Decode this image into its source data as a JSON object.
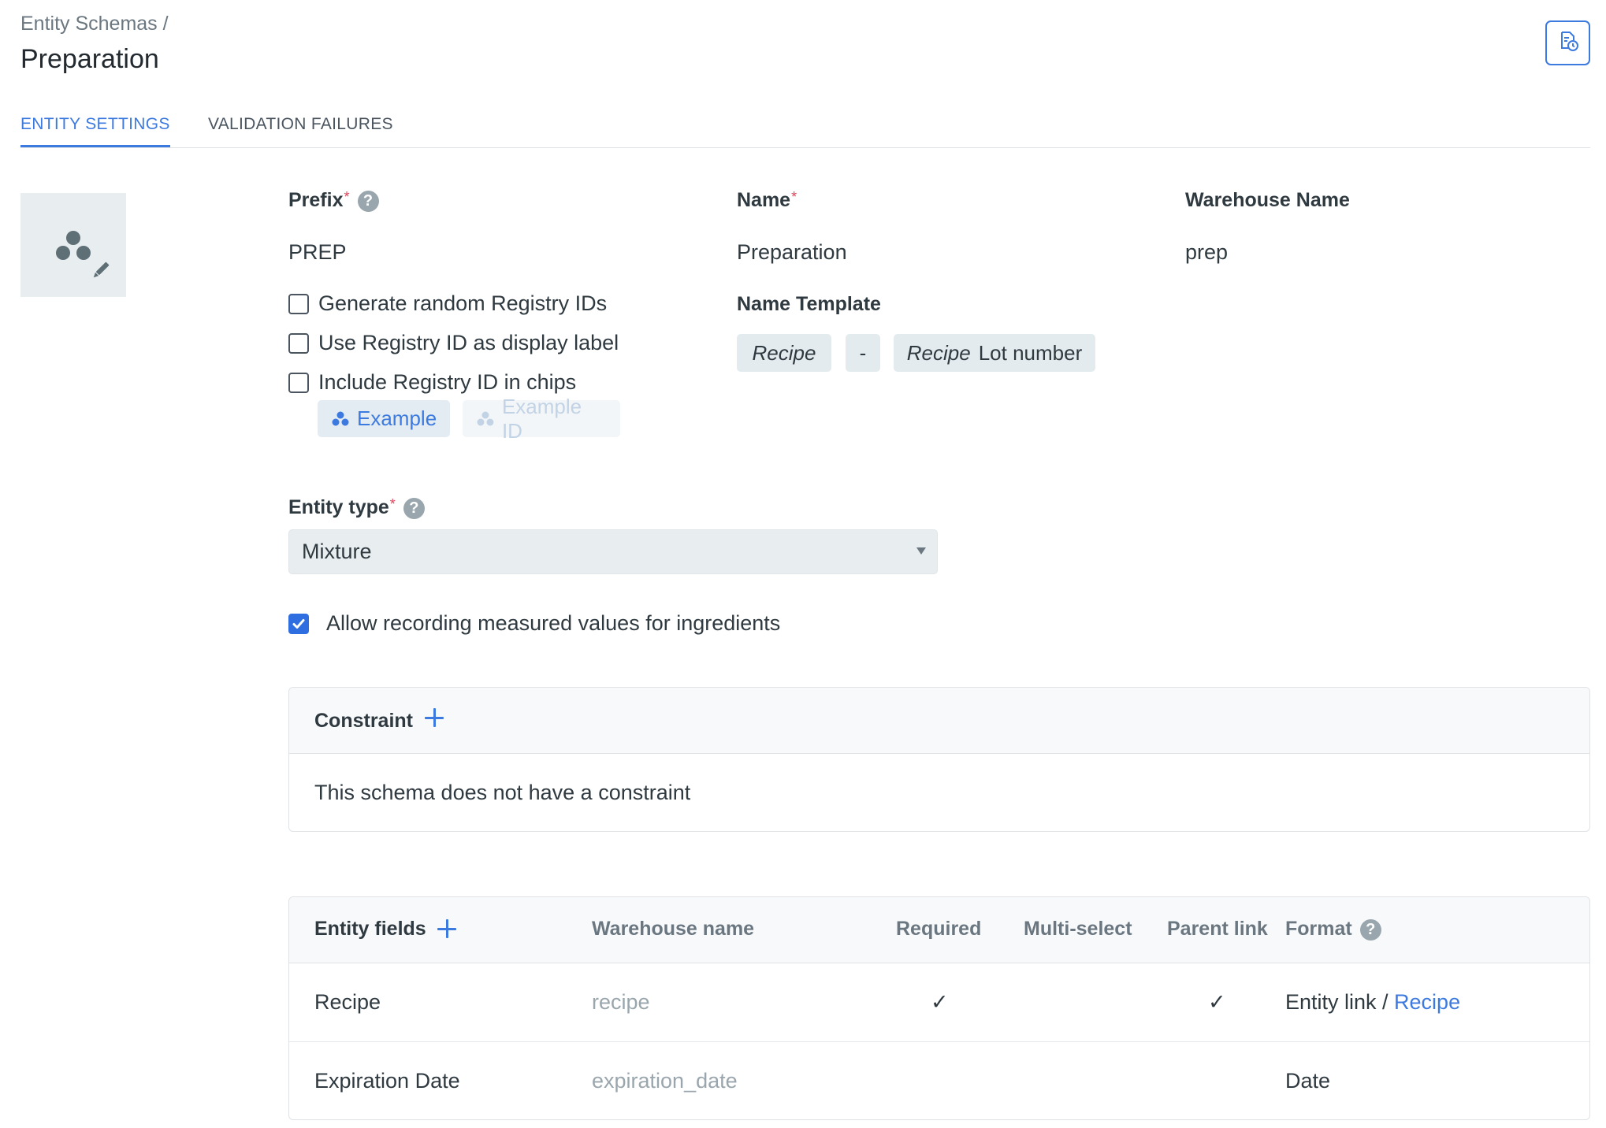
{
  "breadcrumb": {
    "parent": "Entity Schemas /"
  },
  "page": {
    "title": "Preparation"
  },
  "header": {
    "history_icon": "history-document-icon"
  },
  "tabs": [
    {
      "label": "ENTITY SETTINGS",
      "active": true
    },
    {
      "label": "VALIDATION FAILURES",
      "active": false
    }
  ],
  "settings": {
    "prefix_label": "Prefix",
    "prefix_value": "PREP",
    "name_label": "Name",
    "name_value": "Preparation",
    "warehouse_label": "Warehouse Name",
    "warehouse_value": "prep",
    "required_mark": "*",
    "help_mark": "?",
    "checkboxes": [
      {
        "label": "Generate random Registry IDs",
        "checked": false
      },
      {
        "label": "Use Registry ID as display label",
        "checked": false
      },
      {
        "label": "Include Registry ID in chips",
        "checked": false
      }
    ],
    "chip_examples": {
      "example": "Example",
      "example_id": "Example ID"
    },
    "name_template_label": "Name Template",
    "name_template": [
      {
        "italic": "Recipe",
        "plain": ""
      },
      {
        "italic": "",
        "plain": "-"
      },
      {
        "italic": "Recipe",
        "plain": "Lot number"
      }
    ],
    "entity_type_label": "Entity type",
    "entity_type_value": "Mixture",
    "allow_measured": {
      "label": "Allow recording measured values for ingredients",
      "checked": true
    }
  },
  "constraint": {
    "title": "Constraint",
    "empty_text": "This schema does not have a constraint"
  },
  "fields": {
    "headers": {
      "name": "Entity fields",
      "warehouse": "Warehouse name",
      "required": "Required",
      "multi": "Multi-select",
      "parent": "Parent link",
      "format": "Format"
    },
    "rows": [
      {
        "name": "Recipe",
        "warehouse": "recipe",
        "required": "✓",
        "multi": "",
        "parent": "✓",
        "format": "Entity link / ",
        "format_link": "Recipe"
      },
      {
        "name": "Expiration Date",
        "warehouse": "expiration_date",
        "required": "",
        "multi": "",
        "parent": "",
        "format": "Date",
        "format_link": ""
      }
    ]
  },
  "colors": {
    "accent": "#3d7ae0",
    "required": "#e0445a",
    "muted": "#9aa6ad"
  }
}
